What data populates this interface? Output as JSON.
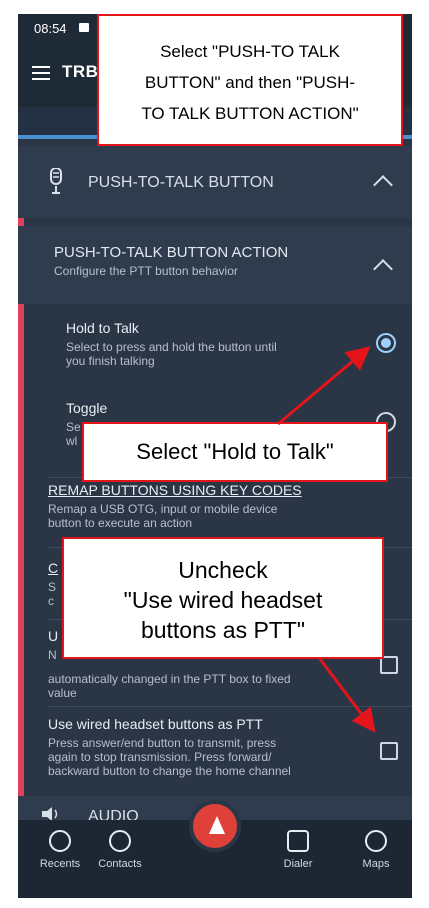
{
  "status_bar": {
    "time": "08:54"
  },
  "app_bar": {
    "title": "TRB"
  },
  "ptt_section": {
    "label": "PUSH-TO-TALK BUTTON"
  },
  "ptt_action": {
    "title": "PUSH-TO-TALK BUTTON ACTION",
    "subtitle": "Configure the PTT button behavior"
  },
  "options": [
    {
      "title": "Hold to Talk",
      "desc_line1": "Select to press and hold the button until",
      "desc_line2": "you finish talking",
      "selected": true
    },
    {
      "title": "Toggle",
      "desc_line1": "Se",
      "desc_line2": "wl",
      "selected": false
    }
  ],
  "remap": {
    "title": "REMAP BUTTONS USING KEY CODES",
    "desc_line1": "Remap a USB OTG, input or mobile device",
    "desc_line2": "button to execute an action"
  },
  "partial_row": {
    "title": "C",
    "desc_line1": "S",
    "desc_line2": "c"
  },
  "fixed_row": {
    "title": "U",
    "desc_line1": "N",
    "desc_line2": "automatically changed in the PTT box to fixed",
    "desc_line3": "value",
    "checked": false
  },
  "headset_row": {
    "title": "Use wired headset buttons as PTT",
    "desc_line1": "Press answer/end button to transmit, press",
    "desc_line2": "again to stop transmission. Press forward/",
    "desc_line3": "backward button to change the home channel",
    "checked": false
  },
  "audio_section": {
    "label": "AUDIO"
  },
  "bottom_nav": {
    "recents": "Recents",
    "contacts": "Contacts",
    "dialer": "Dialer",
    "maps": "Maps"
  },
  "callouts": {
    "top": [
      "Select \"PUSH-TO TALK",
      "BUTTON\" and then \"PUSH-",
      "TO TALK BUTTON ACTION\""
    ],
    "middle": "Select \"Hold to Talk\"",
    "bottom": [
      "Uncheck",
      "\"Use wired headset",
      "buttons as PTT\""
    ]
  },
  "colors": {
    "accent_red": "#e0405a",
    "annotation_red": "#e3151a",
    "selected_radio": "#9ed0ff",
    "background": "#2a3646"
  }
}
